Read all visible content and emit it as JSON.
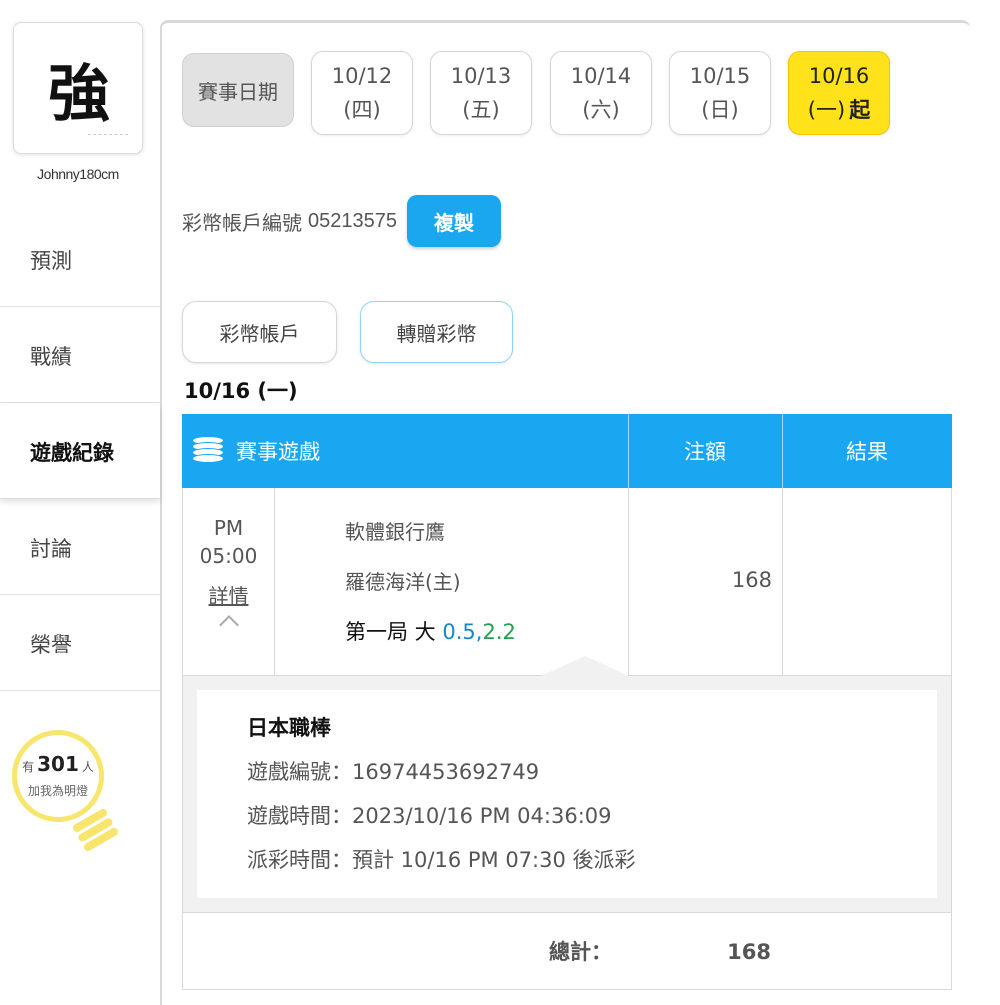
{
  "sidebar": {
    "avatar_glyph": "強",
    "username": "Johnny180cm",
    "items": [
      {
        "label": "預測"
      },
      {
        "label": "戰績"
      },
      {
        "label": "遊戲紀錄"
      },
      {
        "label": "討論"
      },
      {
        "label": "榮譽"
      }
    ],
    "fans": {
      "prefix": "有",
      "count": "301",
      "suffix": "人",
      "caption": "加我為明燈"
    }
  },
  "date_bar": {
    "label": "賽事日期",
    "dates": [
      {
        "date": "10/12",
        "day": "(四)",
        "suffix": ""
      },
      {
        "date": "10/13",
        "day": "(五)",
        "suffix": ""
      },
      {
        "date": "10/14",
        "day": "(六)",
        "suffix": ""
      },
      {
        "date": "10/15",
        "day": "(日)",
        "suffix": ""
      },
      {
        "date": "10/16",
        "day": "(一)",
        "suffix": "起"
      }
    ]
  },
  "account": {
    "label": "彩幣帳戶編號",
    "number": "05213575",
    "copy_label": "複製"
  },
  "tabs": [
    {
      "label": "彩幣帳戶"
    },
    {
      "label": "轉贈彩幣"
    }
  ],
  "date_heading": "10/16 (一)",
  "table": {
    "headers": {
      "game": "賽事遊戲",
      "stake": "注額",
      "result": "結果"
    },
    "row": {
      "time_period": "PM",
      "time": "05:00",
      "detail_link": "詳情",
      "team_away": "軟體銀行鷹",
      "team_home": "羅德海洋(主)",
      "bet_prefix": "第一局 大",
      "odds_line": "0.5,",
      "odds_value": "2.2",
      "stake": "168",
      "result": ""
    },
    "detail": {
      "league": "日本職棒",
      "game_id": "遊戲編號：16974453692749",
      "game_time": "遊戲時間：2023/10/16 PM 04:36:09",
      "payout_time": "派彩時間：預計 10/16 PM 07:30 後派彩"
    },
    "total": {
      "label": "總計：",
      "value": "168"
    }
  },
  "colors": {
    "accent_blue": "#18a7f0",
    "active_date_yellow": "#ffe21a",
    "bulb_yellow": "#f7e56d",
    "odds_blue": "#1a86c7",
    "odds_green": "#23a04a"
  }
}
